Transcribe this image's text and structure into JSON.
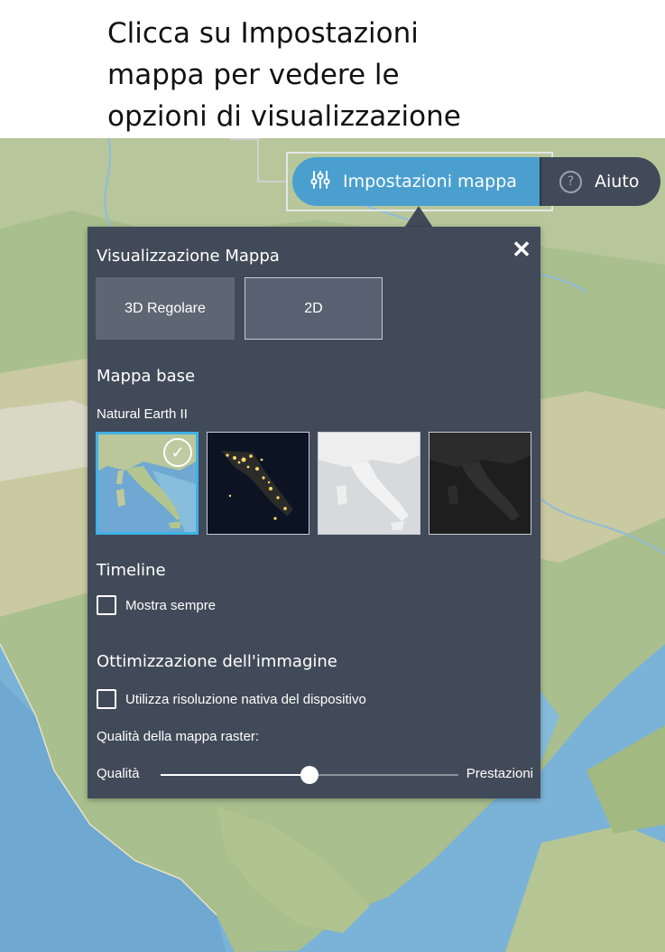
{
  "caption": {
    "line1": "Clicca su Impostazioni",
    "line2": "mappa per vedere le",
    "line3": "opzioni di visualizzazione"
  },
  "toolbar": {
    "settings_label": "Impostazioni mappa",
    "help_label": "Aiuto",
    "settings_icon": "sliders-icon",
    "help_icon": "question-circle-icon"
  },
  "panel": {
    "close_glyph": "✕",
    "view_title": "Visualizzazione Mappa",
    "view_modes": [
      {
        "label": "3D Regolare",
        "active": false
      },
      {
        "label": "2D",
        "active": true
      }
    ],
    "basemap_title": "Mappa base",
    "basemap_selected": "Natural Earth II",
    "basemaps": [
      {
        "name": "natural-earth-ii",
        "selected": true
      },
      {
        "name": "night-lights",
        "selected": false
      },
      {
        "name": "light-gray",
        "selected": false
      },
      {
        "name": "dark-gray",
        "selected": false
      }
    ],
    "timeline_title": "Timeline",
    "timeline_option": "Mostra sempre",
    "timeline_checked": false,
    "optimization_title": "Ottimizzazione dell'immagine",
    "native_resolution_option": "Utilizza risoluzione nativa del dispositivo",
    "native_resolution_checked": false,
    "raster_quality_label": "Qualità della mappa raster:",
    "slider_left": "Qualità",
    "slider_right": "Prestazioni",
    "slider_value": 0.5
  },
  "colors": {
    "accent": "#4a9fcf",
    "panel_bg": "#414a58",
    "selected_border": "#3fb2e6"
  }
}
